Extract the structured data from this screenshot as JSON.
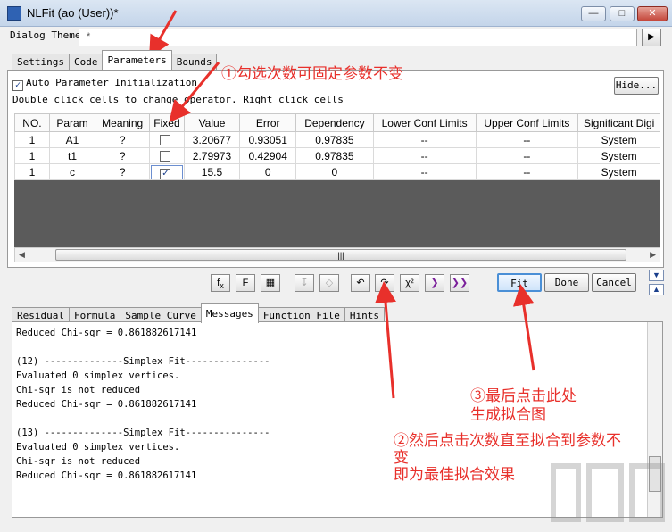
{
  "window": {
    "title": "NLFit (ao (User))*"
  },
  "theme": {
    "label": "Dialog Theme",
    "value": "*"
  },
  "top_tabs": [
    {
      "label": "Settings",
      "active": false
    },
    {
      "label": "Code",
      "active": false
    },
    {
      "label": "Parameters",
      "active": true
    },
    {
      "label": "Bounds",
      "active": false
    }
  ],
  "params": {
    "auto_init_label": "Auto Parameter Initialization",
    "auto_init_checked": true,
    "hint": "Double click cells to change operator. Right click cells",
    "hide_button": "Hide..."
  },
  "table": {
    "headers": [
      "NO.",
      "Param",
      "Meaning",
      "Fixed",
      "Value",
      "Error",
      "Dependency",
      "Lower Conf Limits",
      "Upper Conf Limits",
      "Significant Digi"
    ],
    "rows": [
      {
        "no": "1",
        "param": "A1",
        "meaning": "?",
        "fixed": false,
        "value": "3.20677",
        "error": "0.93051",
        "dependency": "0.97835",
        "lower": "--",
        "upper": "--",
        "sig": "System"
      },
      {
        "no": "1",
        "param": "t1",
        "meaning": "?",
        "fixed": false,
        "value": "2.79973",
        "error": "0.42904",
        "dependency": "0.97835",
        "lower": "--",
        "upper": "--",
        "sig": "System"
      },
      {
        "no": "1",
        "param": "c",
        "meaning": "?",
        "fixed": true,
        "value": "15.5",
        "error": "0",
        "dependency": "0",
        "lower": "--",
        "upper": "--",
        "sig": "System"
      }
    ]
  },
  "buttons": {
    "fit": "Fit",
    "done": "Done",
    "cancel": "Cancel"
  },
  "bottom_tabs": [
    {
      "label": "Residual",
      "active": false
    },
    {
      "label": "Formula",
      "active": false
    },
    {
      "label": "Sample Curve",
      "active": false
    },
    {
      "label": "Messages",
      "active": true
    },
    {
      "label": "Function File",
      "active": false
    },
    {
      "label": "Hints",
      "active": false
    }
  ],
  "messages": [
    "Reduced Chi-sqr = 0.861882617141",
    "",
    "(12) --------------Simplex Fit---------------",
    "Evaluated 0 simplex vertices.",
    "Chi-sqr is not reduced",
    "Reduced Chi-sqr = 0.861882617141",
    "",
    "(13) --------------Simplex Fit---------------",
    "Evaluated 0 simplex vertices.",
    "Chi-sqr is not reduced",
    "Reduced Chi-sqr = 0.861882617141"
  ],
  "annotations": {
    "a1": "①勾选次数可固定参数不变",
    "a3_line1": "③最后点击此处",
    "a3_line2": "生成拟合图",
    "a2_line1": "②然后点击次数直至拟合到参数不",
    "a2_line2": "变",
    "a2_line3": "即为最佳拟合效果"
  },
  "colors": {
    "annotation": "#e8302b",
    "fit_border": "#4a8fd6"
  }
}
